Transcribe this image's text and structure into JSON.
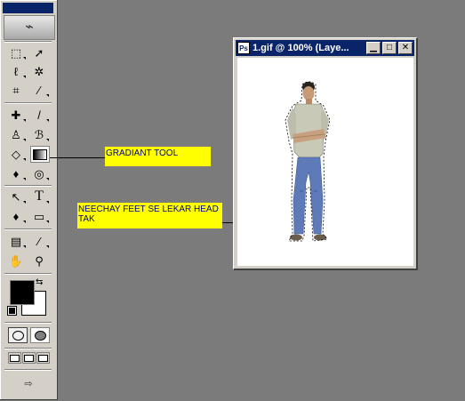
{
  "toolbox": {
    "tools": [
      {
        "name": "marquee-tool",
        "glyph": "⬚"
      },
      {
        "name": "move-tool",
        "glyph": "➚"
      },
      {
        "name": "lasso-tool",
        "glyph": "ℓ"
      },
      {
        "name": "magic-wand-tool",
        "glyph": "✲"
      },
      {
        "name": "crop-tool",
        "glyph": "⌗"
      },
      {
        "name": "slice-tool",
        "glyph": "⁄"
      },
      {
        "name": "healing-brush-tool",
        "glyph": "✚"
      },
      {
        "name": "brush-tool",
        "glyph": "/"
      },
      {
        "name": "clone-stamp-tool",
        "glyph": "♙"
      },
      {
        "name": "history-brush-tool",
        "glyph": "ℬ"
      },
      {
        "name": "eraser-tool",
        "glyph": "◇"
      },
      {
        "name": "gradient-tool",
        "glyph": ""
      },
      {
        "name": "blur-tool",
        "glyph": "♦"
      },
      {
        "name": "dodge-tool",
        "glyph": "◎"
      },
      {
        "name": "path-selection-tool",
        "glyph": "↖"
      },
      {
        "name": "type-tool",
        "glyph": "T"
      },
      {
        "name": "pen-tool",
        "glyph": "♦"
      },
      {
        "name": "shape-tool",
        "glyph": "▭"
      },
      {
        "name": "notes-tool",
        "glyph": "▤"
      },
      {
        "name": "eyedropper-tool",
        "glyph": "⁄"
      },
      {
        "name": "hand-tool",
        "glyph": "✋"
      },
      {
        "name": "zoom-tool",
        "glyph": "⚲"
      }
    ],
    "swap_glyph": "⇆",
    "logo_glyph": "⌁",
    "jump_glyph": "⇨",
    "foreground_color": "#000000",
    "background_color": "#ffffff"
  },
  "annotations": {
    "gradient_label": "GRADIANT TOOL",
    "direction_label": "NEECHAY FEET SE LEKAR HEAD TAK"
  },
  "document": {
    "title": "1.gif @ 100% (Laye...",
    "min_glyph": "▁",
    "max_glyph": "□",
    "close_glyph": "✕",
    "icon_glyph": "Ps"
  },
  "colors": {
    "workspace": "#7b7b7b",
    "label_bg": "#ffff00",
    "label_text": "#00008b",
    "titlebar": "#0a246a"
  }
}
